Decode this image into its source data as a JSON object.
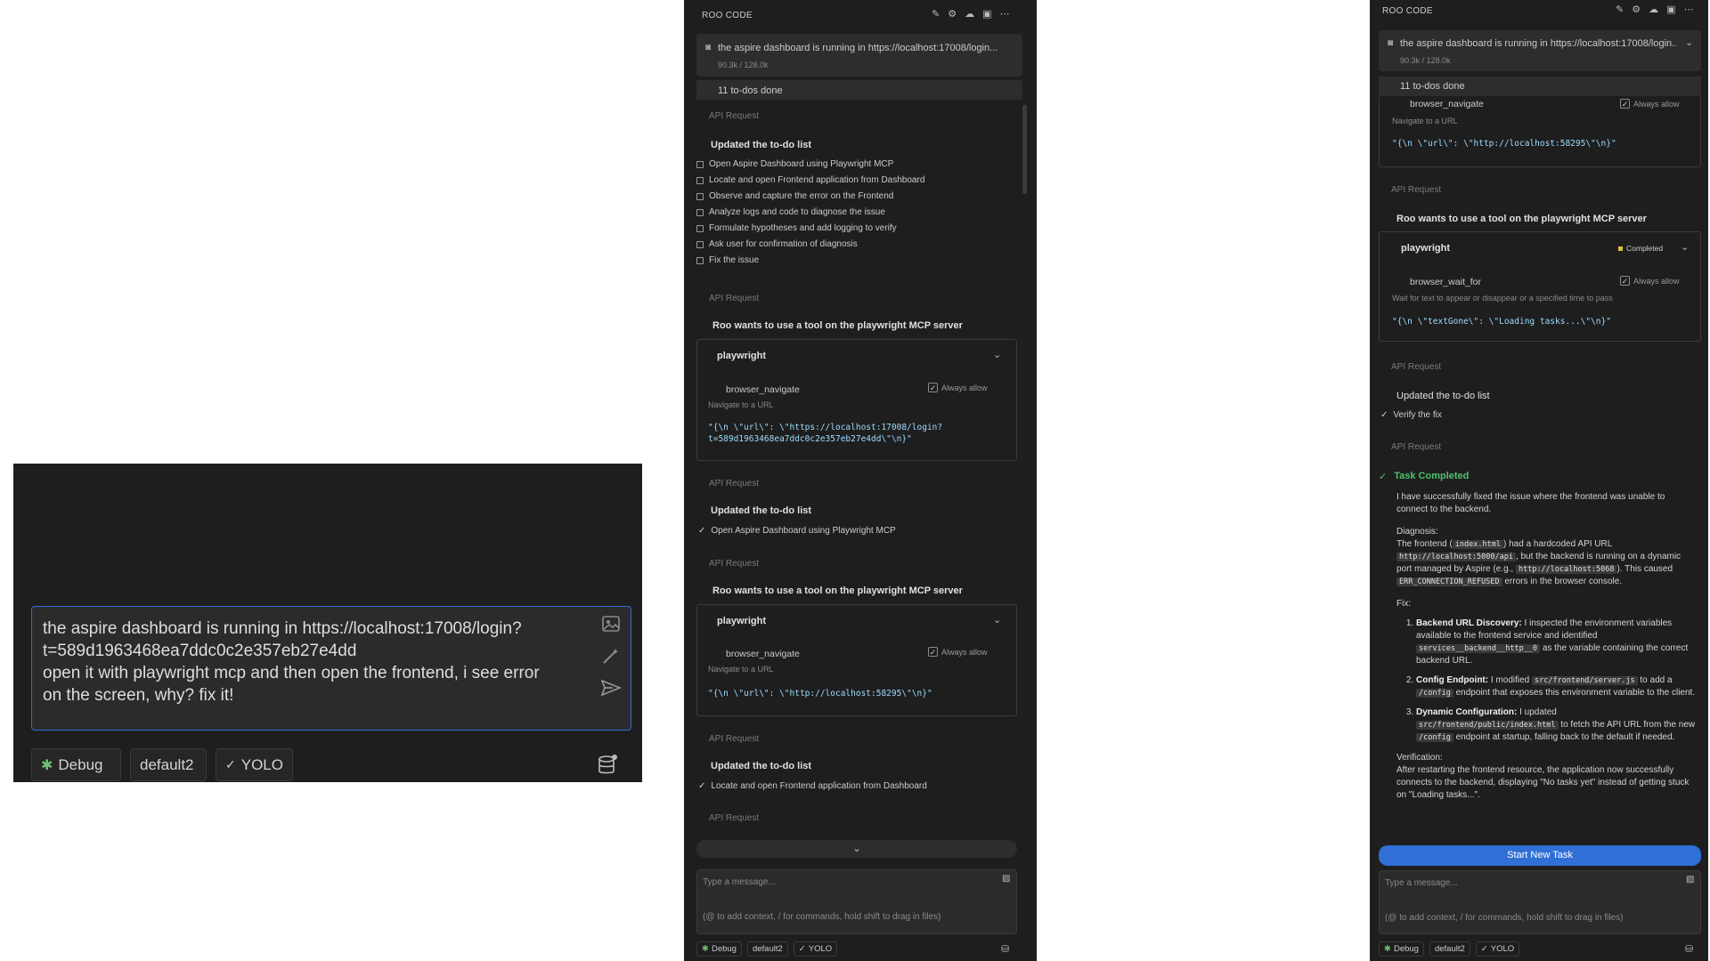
{
  "panel1": {
    "input_text_line1": "the aspire dashboard is running in https://localhost:17008/login?",
    "input_text_line2": "t=589d1963468ea7ddc0c2e357eb27e4dd",
    "input_text_line3": "open it with playwright mcp and then open the frontend, i see error",
    "input_text_line4": "on the screen, why? fix it!",
    "mode_label": "Debug",
    "profile_label": "default2",
    "yolo_label": "YOLO"
  },
  "panel2": {
    "header_title": "ROO CODE",
    "task_title": "the aspire dashboard is running in https://localhost:17008/login...",
    "task_tokens": "90.3k / 128.0k",
    "todos_done": "11 to-dos done",
    "api_request": "API Request",
    "todo_update_title": "Updated the to-do list",
    "todos": [
      "Open Aspire Dashboard using Playwright MCP",
      "Locate and open Frontend application from Dashboard",
      "Observe and capture the error on the Frontend",
      "Analyze logs and code to diagnose the issue",
      "Formulate hypotheses and add logging to verify",
      "Ask user for confirmation of diagnosis",
      "Fix the issue"
    ],
    "mcp_title": "Roo wants to use a tool on the playwright MCP server",
    "server_name": "playwright",
    "tool_navigate": "browser_navigate",
    "tool_navigate_desc": "Navigate to a URL",
    "always_allow": "Always allow",
    "args1_line1": "\"{\\n  \\\"url\\\": \\\"https://localhost:17008/login?",
    "args1_line2": "t=589d1963468ea7ddc0c2e357eb27e4dd\\\"\\n}\"",
    "todo_done_1": "Open Aspire Dashboard using Playwright MCP",
    "args2": "\"{\\n  \\\"url\\\": \\\"http://localhost:58295\\\"\\n}\"",
    "todo_done_2": "Locate and open Frontend application from Dashboard",
    "message_placeholder": "Type a message...",
    "message_hint": "(@ to add context, / for commands, hold shift to drag in files)",
    "mode_label": "Debug",
    "profile_label": "default2",
    "yolo_label": "YOLO"
  },
  "panel3": {
    "header_title": "ROO CODE",
    "task_title": "the aspire dashboard is running in https://localhost:17008/login...",
    "task_tokens": "90.3k / 128.0k",
    "todos_done": "11 to-dos done",
    "tool_navigate": "browser_navigate",
    "tool_navigate_desc": "Navigate to a URL",
    "always_allow": "Always allow",
    "args_navigate": "\"{\\n  \\\"url\\\": \\\"http://localhost:58295\\\"\\n}\"",
    "api_request": "API Request",
    "mcp_title": "Roo wants to use a tool on the playwright MCP server",
    "server_name": "playwright",
    "completed_badge": "Completed",
    "tool_wait": "browser_wait_for",
    "tool_wait_desc": "Wait for text to appear or disappear or a specified time to pass",
    "args_wait": "\"{\\n  \\\"textGone\\\": \\\"Loading tasks...\\\"\\n}\"",
    "todo_update_title": "Updated the to-do list",
    "todo_verify": "Verify the fix",
    "task_completed": "Task Completed",
    "result_intro": "I have successfully fixed the issue where the frontend was unable to connect to the backend.",
    "diagnosis_label": "Diagnosis:",
    "diag_1": "The frontend (",
    "diag_code_1": "index.html",
    "diag_2": ") had a hardcoded API URL",
    "diag_code_2": "http://localhost:5000/api",
    "diag_3": ", but the backend is running on a dynamic port managed by Aspire (e.g.,",
    "diag_code_3": "http://localhost:5068",
    "diag_4": "). This caused",
    "diag_code_4": "ERR_CONNECTION_REFUSED",
    "diag_5": "errors in the browser console.",
    "fix_label": "Fix:",
    "fix1_bold": "Backend URL Discovery:",
    "fix1_text": "I inspected the environment variables available to the frontend service and identified",
    "fix1_code": "services__backend__http__0",
    "fix1_text2": "as the variable containing the correct backend URL.",
    "fix2_bold": "Config Endpoint:",
    "fix2_text": "I modified",
    "fix2_code": "src/frontend/server.js",
    "fix2_text2": "to add a",
    "fix2_code2": "/config",
    "fix2_text3": "endpoint that exposes this environment variable to the client.",
    "fix3_bold": "Dynamic Configuration:",
    "fix3_text": "I updated",
    "fix3_code": "src/frontend/public/index.html",
    "fix3_text2": "to fetch the API URL from the new",
    "fix3_code2": "/config",
    "fix3_text3": "endpoint at startup, falling back to the default if needed.",
    "verification_label": "Verification:",
    "verification_text": "After restarting the frontend resource, the application now successfully connects to the backend, displaying \"No tasks yet\" instead of getting stuck on \"Loading tasks...\".",
    "new_task_button": "Start New Task",
    "message_placeholder": "Type a message...",
    "message_hint": "(@ to add context, / for commands, hold shift to drag in files)",
    "mode_label": "Debug",
    "profile_label": "default2",
    "yolo_label": "YOLO"
  }
}
